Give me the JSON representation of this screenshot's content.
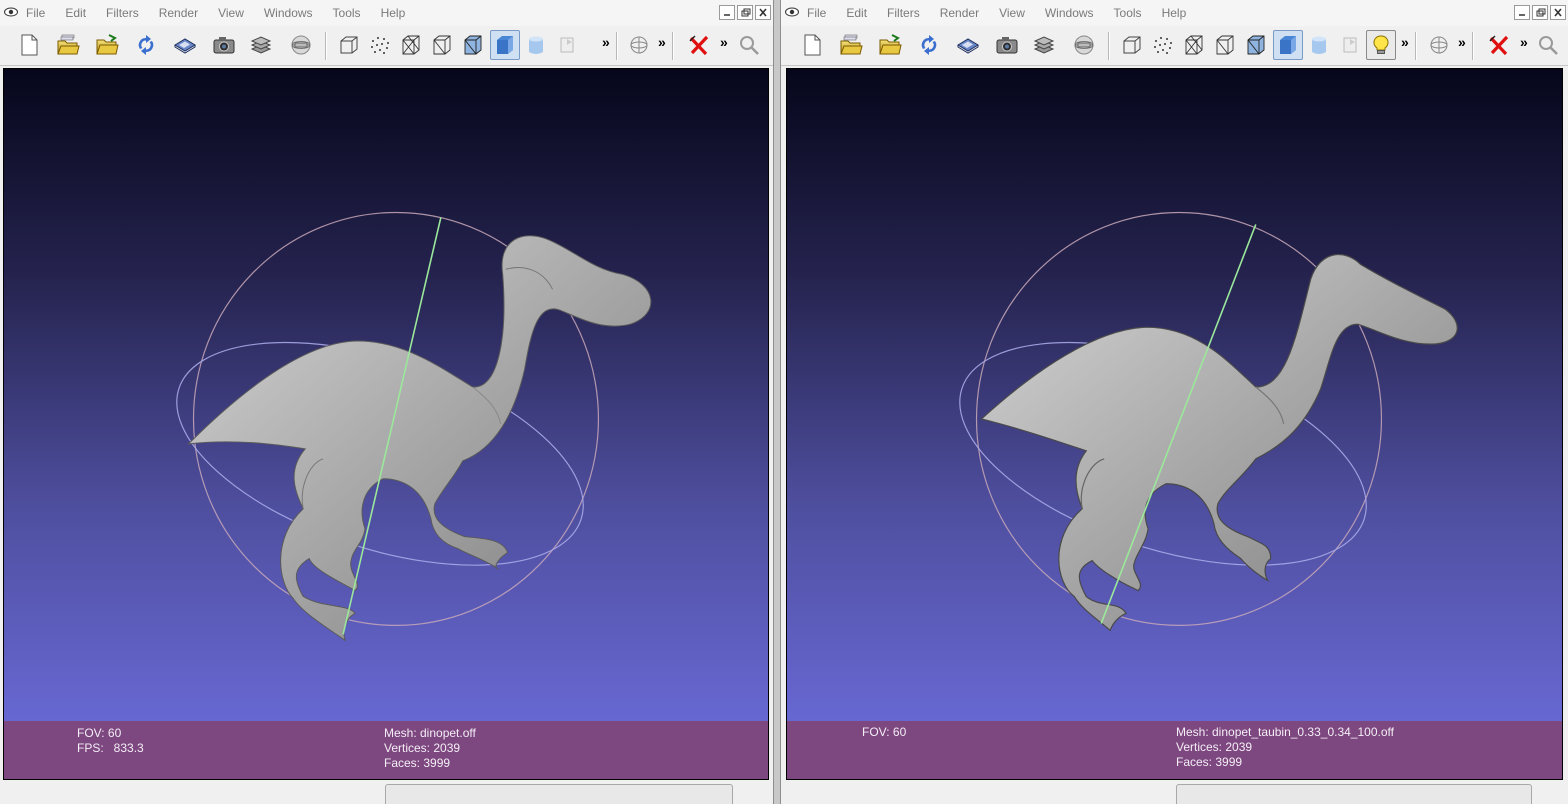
{
  "menu": [
    "File",
    "Edit",
    "Filters",
    "Render",
    "View",
    "Windows",
    "Tools",
    "Help"
  ],
  "left": {
    "info": {
      "fov": "FOV: 60",
      "fps": "FPS:   833.3",
      "mesh": "Mesh: dinopet.off",
      "vertices": "Vertices: 2039",
      "faces": "Faces: 3999"
    }
  },
  "right": {
    "info": {
      "fov": "FOV: 60",
      "mesh": "Mesh: dinopet_taubin_0.33_0.34_100.off",
      "vertices": "Vertices: 2039",
      "faces": "Faces: 3999"
    }
  },
  "toolbar_icons": [
    "new-document-icon",
    "open-project-icon",
    "open-mesh-icon",
    "reload-icon",
    "save-icon",
    "snapshot-camera-icon",
    "layers-icon",
    "globe-render-icon",
    "bounding-box-icon",
    "points-icon",
    "wireframe-icon",
    "hidden-lines-icon",
    "flat-lines-icon",
    "flat-shading-icon",
    "smooth-shading-icon",
    "texture-icon",
    "light-bulb-icon",
    "sphere-icon",
    "delete-red-x-icon",
    "search-magnifier-icon"
  ],
  "colors": {
    "info_bar": "#7d477f",
    "viewport_top": "#06061b",
    "viewport_bottom": "#6e6ee0",
    "mesh": "#b9b9b9",
    "trackball_axis": "#9be89b"
  }
}
